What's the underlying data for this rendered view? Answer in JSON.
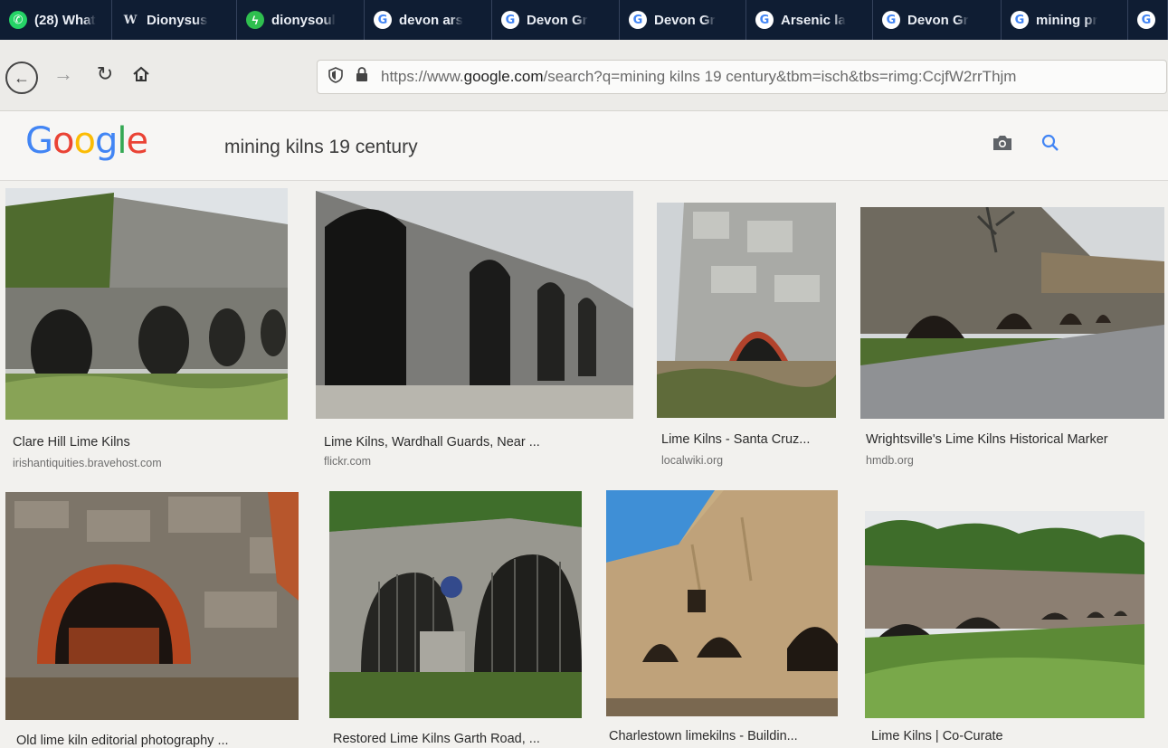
{
  "tabs": [
    {
      "icon": "whatsapp-icon",
      "label": "(28) What"
    },
    {
      "icon": "wikipedia-icon",
      "label": "Dionysus"
    },
    {
      "icon": "dionysoul-icon",
      "label": "dionysoul"
    },
    {
      "icon": "google-icon",
      "label": "devon ars"
    },
    {
      "icon": "google-icon",
      "label": "Devon Gr"
    },
    {
      "icon": "google-icon",
      "label": "Devon Gr"
    },
    {
      "icon": "google-icon",
      "label": "Arsenic la"
    },
    {
      "icon": "google-icon",
      "label": "Devon Gr"
    },
    {
      "icon": "google-icon",
      "label": "mining pr"
    },
    {
      "icon": "google-icon",
      "label": ""
    }
  ],
  "navbar": {
    "url_prefix": "https://www.",
    "url_domain": "google.com",
    "url_rest": "/search?q=mining kilns 19 century&tbm=isch&tbs=rimg:CcjfW2rrThjm"
  },
  "google": {
    "logo": [
      "G",
      "o",
      "o",
      "g",
      "l",
      "e"
    ],
    "query": "mining kilns 19 century"
  },
  "results": [
    {
      "title": "Clare Hill Lime Kilns",
      "source": "irishantiquities.bravehost.com"
    },
    {
      "title": "Lime Kilns, Wardhall Guards, Near ...",
      "source": "flickr.com"
    },
    {
      "title": "Lime Kilns - Santa Cruz...",
      "source": "localwiki.org"
    },
    {
      "title": "Wrightsville's Lime Kilns Historical Marker",
      "source": "hmdb.org"
    },
    {
      "title": "Old lime kiln editorial photography ...",
      "source": ""
    },
    {
      "title": "Restored Lime Kilns Garth Road, ...",
      "source": ""
    },
    {
      "title": "Charlestown limekilns - Buildin...",
      "source": ""
    },
    {
      "title": "Lime Kilns | Co-Curate",
      "source": ""
    }
  ]
}
